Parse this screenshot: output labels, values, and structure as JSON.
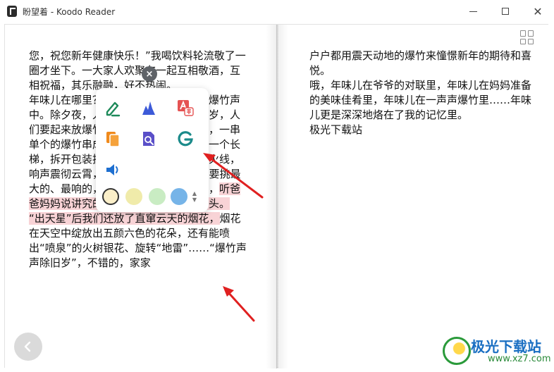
{
  "window": {
    "title": "盼望着 - Koodo Reader"
  },
  "book": {
    "left_page": {
      "segments": [
        {
          "text": "您，祝您新年健康快乐！”我喝饮料轮流敬了一圈才坐下。一大家人欢聚在一起互相敬酒，互相祝福，其乐融融，好不热闹。\n年味儿在哪里？年味儿在那震耳欲聋的爆竹声中。除夕夜，人们都没了睡意，为了守岁，人们要起来放爆竹，我们一家人也不例外，一串单个的爆竹串成串，挂在竹竿上，要找一个长梯，拆开包装挂起来，拿起火把点燃导火线，响声震彻云霄，“出天星”这一挂鞭炮人要挑最大的、最响的，点火把也要烧的最旺的，",
          "style": "plain"
        },
        {
          "text": "听爸爸妈妈说讲究的是新年红红火火的好兆头。\n“出天星”后我们还放了直窜云天的烟花，",
          "style": "pink"
        },
        {
          "text": "烟花在天空中绽放出五颜六色的花朵，还有能喷出“喷泉”的火树银花、旋转“地雷”……“爆竹声声除旧岁”，不错的，家家",
          "style": "plain"
        }
      ]
    },
    "right_page": {
      "text": "户户都用震天动地的爆竹来憧憬新年的期待和喜悦。\n哦，年味儿在爷爷的对联里，年味儿在妈妈准备的美味佳肴里，年味儿在一声声爆竹里……年味儿更是深深地烙在了我的记忆里。\n极光下载站"
    }
  },
  "popup": {
    "close_label": "×",
    "tools": [
      {
        "name": "note-icon",
        "color": "#1e8a5a"
      },
      {
        "name": "highlight-icon",
        "color": "#3c5ad8"
      },
      {
        "name": "translate-icon",
        "color": "#e55353"
      },
      {
        "name": "copy-icon",
        "color": "#f08a1c"
      },
      {
        "name": "search-book-icon",
        "color": "#5a4fc8"
      },
      {
        "name": "google-search-icon",
        "color": "#1b8a8a"
      },
      {
        "name": "speak-icon",
        "color": "#1e6fd0"
      }
    ],
    "swatches": [
      "#fbefc9",
      "#f0ebaa",
      "#c9ecc3",
      "#76b4e8"
    ],
    "stepper_up": "▲",
    "stepper_down": "▼"
  },
  "watermark": {
    "name": "极光下载站",
    "url": "www.xz7.com"
  }
}
